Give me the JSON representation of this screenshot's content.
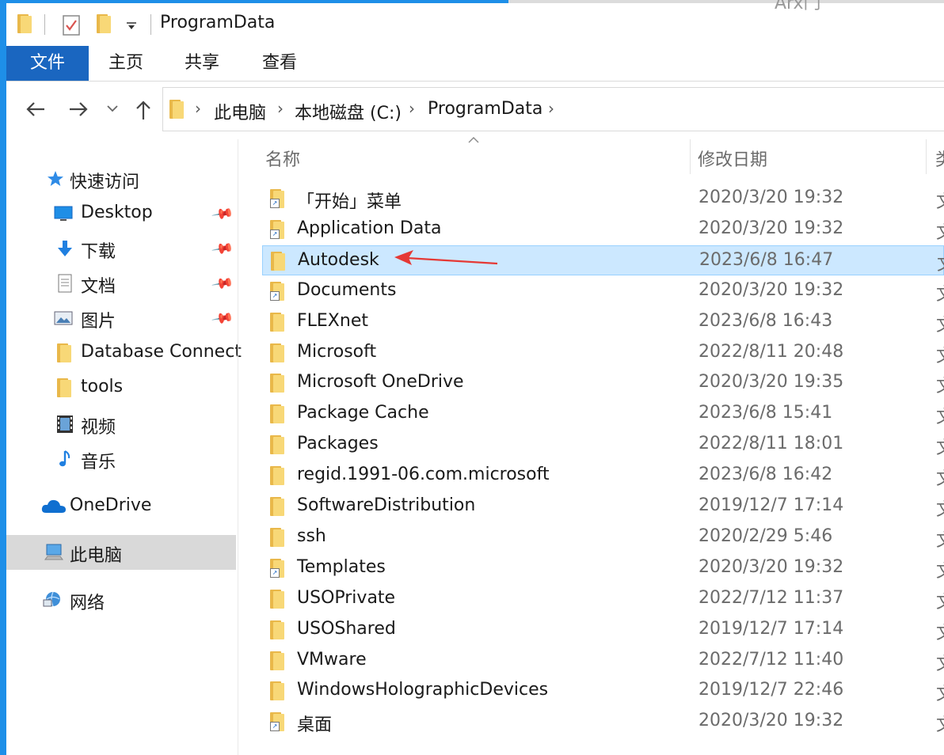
{
  "window": {
    "title": "ProgramData",
    "background_window_text": "Arx门"
  },
  "ribbon": {
    "tabs": [
      {
        "label": "文件"
      },
      {
        "label": "主页"
      },
      {
        "label": "共享"
      },
      {
        "label": "查看"
      }
    ]
  },
  "breadcrumb": [
    "此电脑",
    "本地磁盘 (C:)",
    "ProgramData"
  ],
  "sidebar": {
    "quick_access": "快速访问",
    "items": [
      {
        "label": "Desktop",
        "icon": "desktop-icon",
        "pinned": true
      },
      {
        "label": "下载",
        "icon": "download-icon",
        "pinned": true
      },
      {
        "label": "文档",
        "icon": "document-icon",
        "pinned": true
      },
      {
        "label": "图片",
        "icon": "pictures-icon",
        "pinned": true
      },
      {
        "label": "Database Connect",
        "icon": "folder-icon",
        "pinned": false
      },
      {
        "label": "tools",
        "icon": "folder-icon",
        "pinned": false
      },
      {
        "label": "视频",
        "icon": "video-icon",
        "pinned": false
      },
      {
        "label": "音乐",
        "icon": "music-icon",
        "pinned": false
      }
    ],
    "onedrive": "OneDrive",
    "this_pc": "此电脑",
    "network": "网络"
  },
  "columns": {
    "name": "名称",
    "date_modified": "修改日期",
    "type_partial": "类"
  },
  "files": [
    {
      "name": "「开始」菜单",
      "date": "2020/3/20 19:32",
      "shortcut": true
    },
    {
      "name": "Application Data",
      "date": "2020/3/20 19:32",
      "shortcut": true
    },
    {
      "name": "Autodesk",
      "date": "2023/6/8 16:47",
      "shortcut": false,
      "selected": true
    },
    {
      "name": "Documents",
      "date": "2020/3/20 19:32",
      "shortcut": true
    },
    {
      "name": "FLEXnet",
      "date": "2023/6/8 16:43",
      "shortcut": false
    },
    {
      "name": "Microsoft",
      "date": "2022/8/11 20:48",
      "shortcut": false
    },
    {
      "name": "Microsoft OneDrive",
      "date": "2020/3/20 19:35",
      "shortcut": false
    },
    {
      "name": "Package Cache",
      "date": "2023/6/8 15:41",
      "shortcut": false
    },
    {
      "name": "Packages",
      "date": "2022/8/11 18:01",
      "shortcut": false
    },
    {
      "name": "regid.1991-06.com.microsoft",
      "date": "2023/6/8 16:42",
      "shortcut": false
    },
    {
      "name": "SoftwareDistribution",
      "date": "2019/12/7 17:14",
      "shortcut": false
    },
    {
      "name": "ssh",
      "date": "2020/2/29 5:46",
      "shortcut": false
    },
    {
      "name": "Templates",
      "date": "2020/3/20 19:32",
      "shortcut": true
    },
    {
      "name": "USOPrivate",
      "date": "2022/7/12 11:37",
      "shortcut": false
    },
    {
      "name": "USOShared",
      "date": "2019/12/7 17:14",
      "shortcut": false
    },
    {
      "name": "VMware",
      "date": "2022/7/12 11:40",
      "shortcut": false
    },
    {
      "name": "WindowsHolographicDevices",
      "date": "2019/12/7 22:46",
      "shortcut": false
    },
    {
      "name": "桌面",
      "date": "2020/3/20 19:32",
      "shortcut": true
    }
  ],
  "type_glyph": "文",
  "colors": {
    "accent": "#1a66c0",
    "window_border": "#1e8fe8",
    "selection": "#cce8ff",
    "folder": "#f8d877",
    "annotation_arrow": "#e53935"
  }
}
